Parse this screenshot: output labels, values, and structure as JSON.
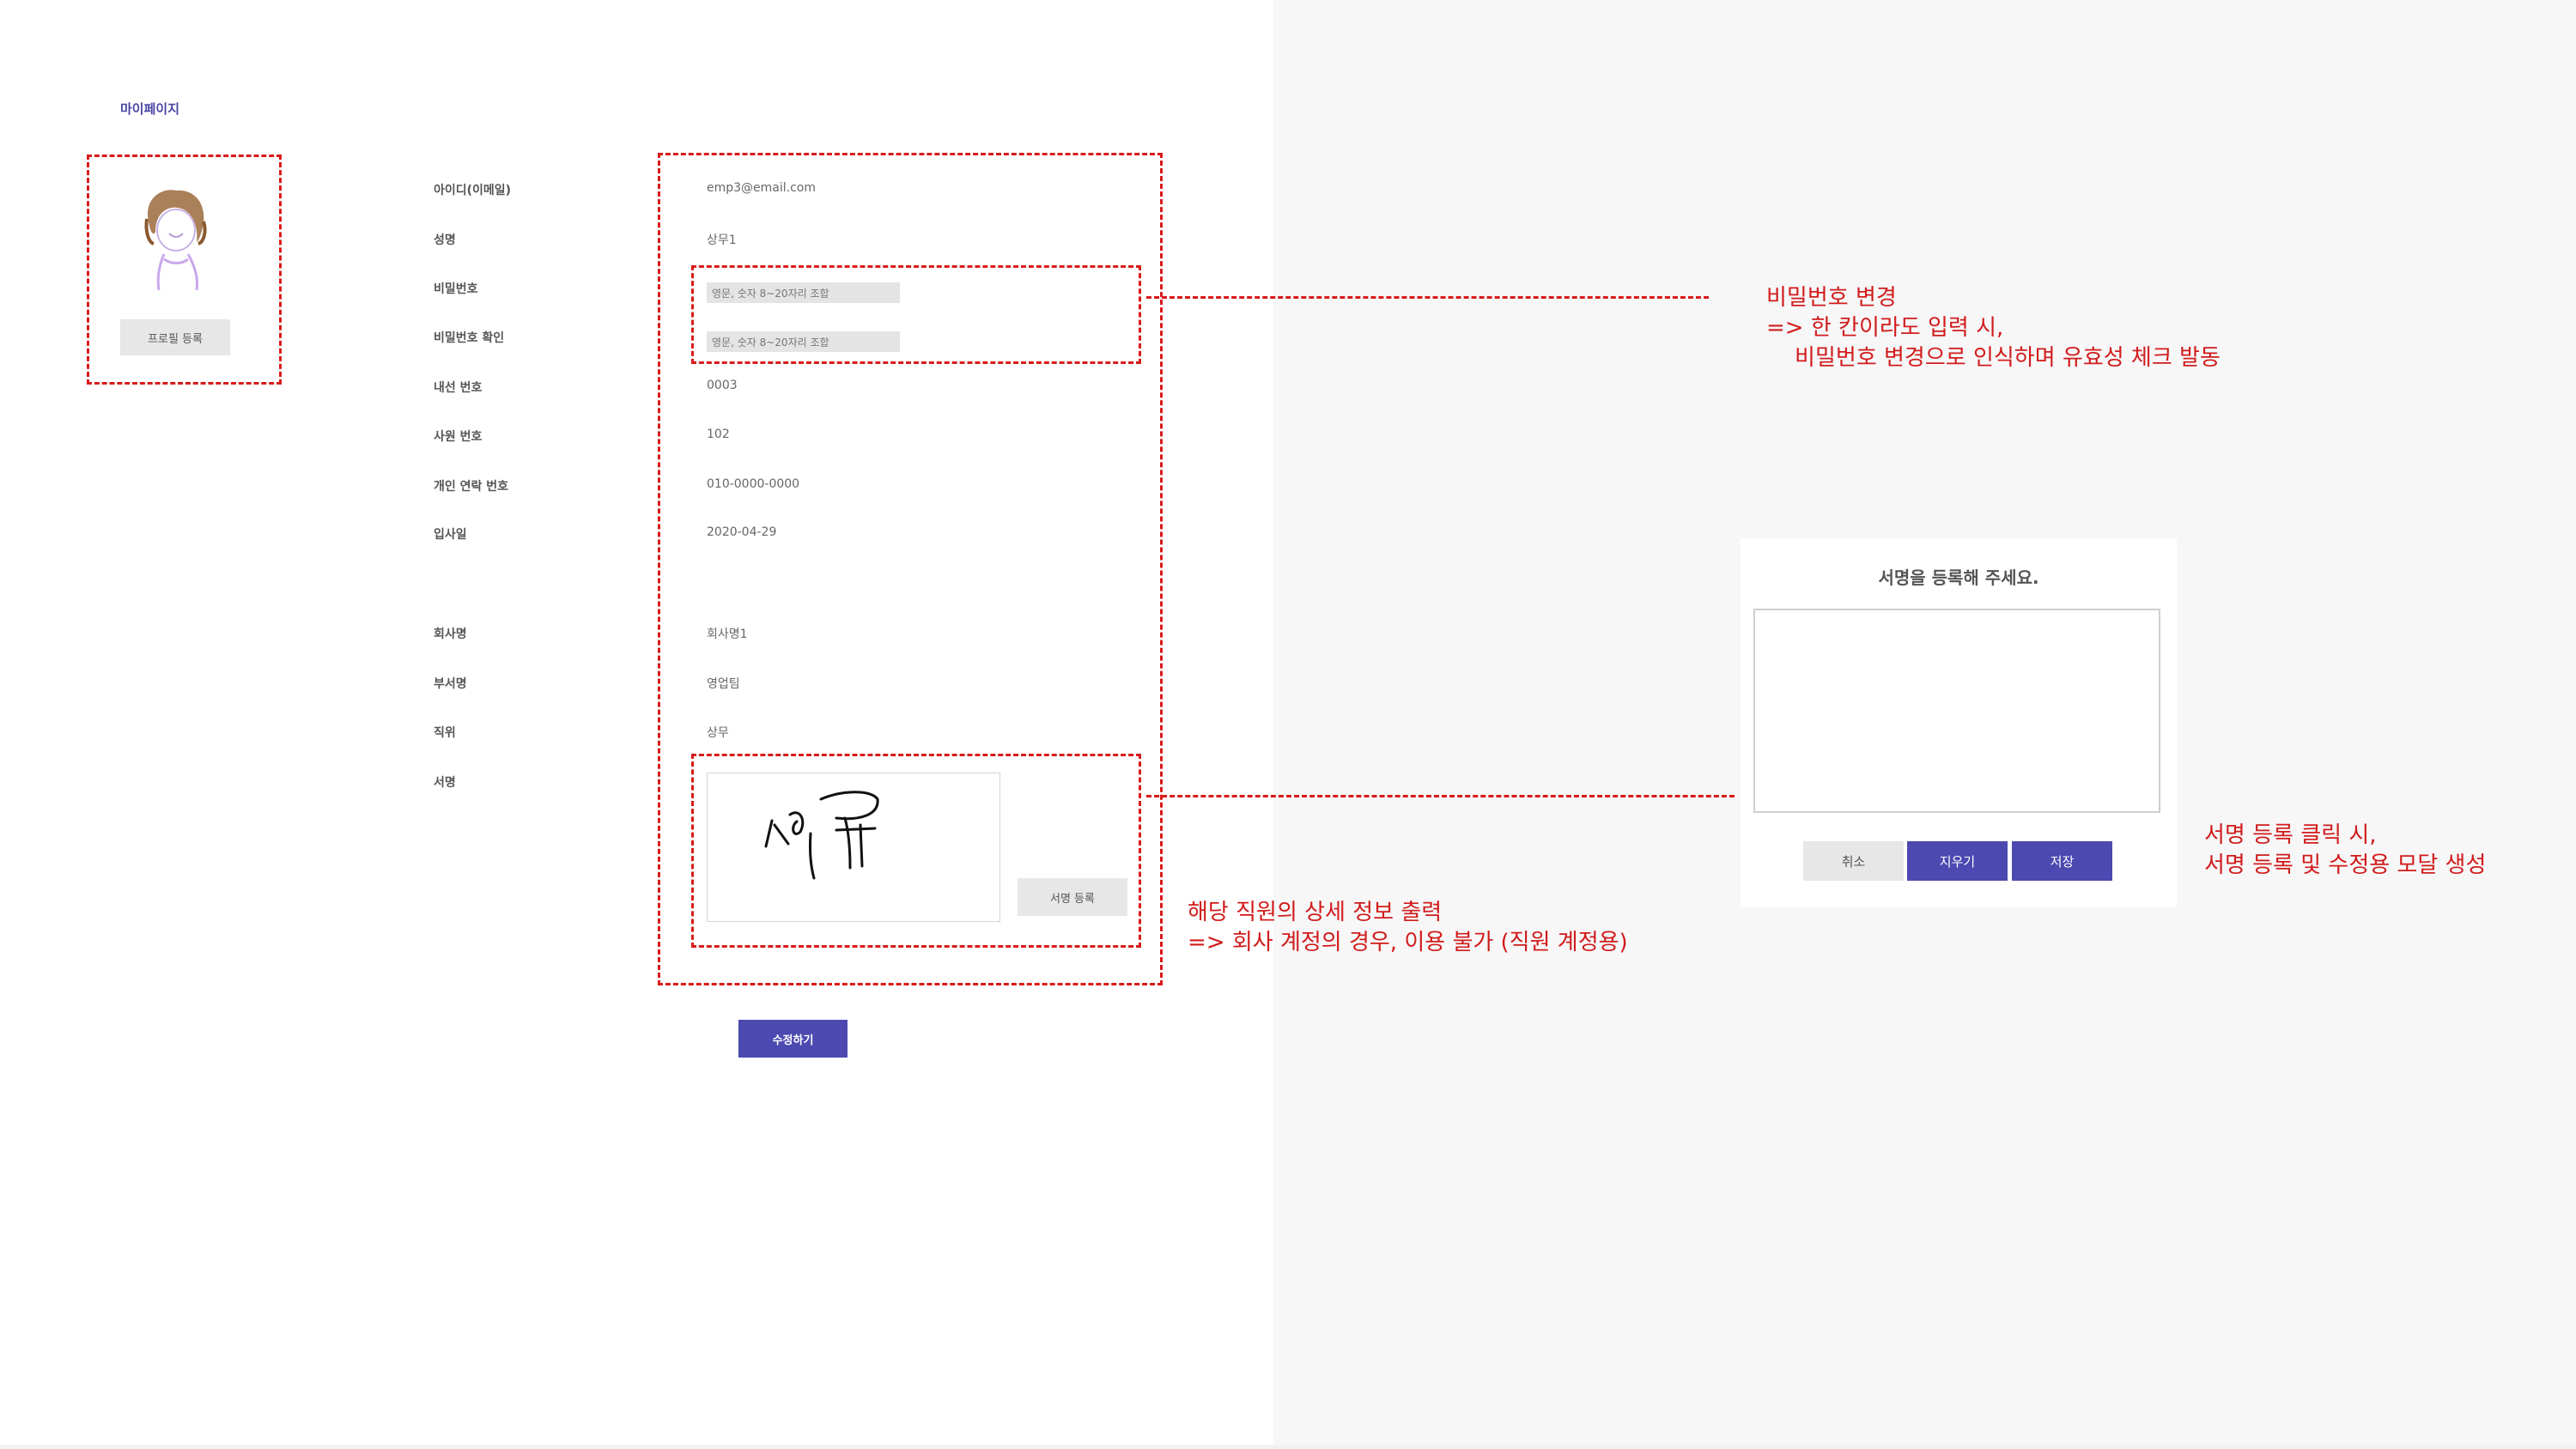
{
  "page": {
    "title": "마이페이지"
  },
  "profile": {
    "register_button": "프로필 등록"
  },
  "fields": {
    "id": {
      "label": "아이디(이메일)",
      "value": "emp3@email.com"
    },
    "name": {
      "label": "성명",
      "value": "상무1"
    },
    "password": {
      "label": "비밀번호",
      "placeholder": "영문, 숫자 8~20자리 조합"
    },
    "password_confirm": {
      "label": "비밀번호 확인",
      "placeholder": "영문, 숫자 8~20자리 조합"
    },
    "extension": {
      "label": "내선 번호",
      "value": "0003"
    },
    "employee_no": {
      "label": "사원 번호",
      "value": "102"
    },
    "phone": {
      "label": "개인 연락 번호",
      "value": "010-0000-0000"
    },
    "join_date": {
      "label": "입사일",
      "value": "2020-04-29"
    },
    "company": {
      "label": "회사명",
      "value": "회사명1"
    },
    "department": {
      "label": "부서명",
      "value": "영업팀"
    },
    "position": {
      "label": "직위",
      "value": "상무"
    },
    "signature": {
      "label": "서명",
      "register_button": "서명 등록"
    }
  },
  "submit_button": "수정하기",
  "annotations": {
    "password": "비밀번호 변경\n=> 한 칸이라도 입력 시,\n    비밀번호 변경으로 인식하며 유효성 체크 발동",
    "detail": "해당 직원의 상세 정보 출력\n=> 회사 계정의 경우, 이용 불가 (직원 계정용)",
    "signature_modal": "서명 등록 클릭 시,\n서명 등록 및 수정용 모달 생성"
  },
  "modal": {
    "title": "서명을 등록해 주세요.",
    "cancel": "취소",
    "clear": "지우기",
    "save": "저장"
  },
  "colors": {
    "accent": "#4c49b1",
    "annotation": "#d91a1a",
    "button_grey": "#e7e7e7"
  }
}
